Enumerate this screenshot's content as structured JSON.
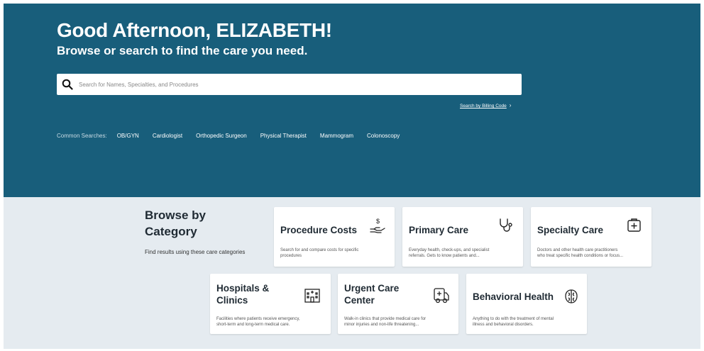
{
  "hero": {
    "greeting": "Good Afternoon, ELIZABETH!",
    "subtitle": "Browse or search to find the care you need.",
    "search_placeholder": "Search for Names, Specialties, and Procedures",
    "billing_link": "Search by Billing Code",
    "common_label": "Common Searches:",
    "common_searches": [
      "OB/GYN",
      "Cardiologist",
      "Orthopedic Surgeon",
      "Physical Therapist",
      "Mammogram",
      "Colonoscopy"
    ]
  },
  "browse": {
    "title": "Browse by\nCategory",
    "description": "Find results using these care categories"
  },
  "categories": [
    {
      "title": "Procedure Costs",
      "icon": "hand-dollar-icon",
      "description": "Search for and compare costs for specific\nprocedures"
    },
    {
      "title": "Primary Care",
      "icon": "stethoscope-icon",
      "description": "Everyday health, check-ups, and specialist\nreferrals. Gets to know patients and..."
    },
    {
      "title": "Specialty Care",
      "icon": "medical-kit-icon",
      "description": "Doctors and other health care practitioners\nwho treat specific health conditions or focus..."
    },
    {
      "title": "Hospitals &\nClinics",
      "icon": "hospital-icon",
      "description": "Facilities where patients receive emergency,\nshort-term and long-term medical care."
    },
    {
      "title": "Urgent Care\nCenter",
      "icon": "ambulance-icon",
      "description": "Walk-in clinics that provide medical care for\nminor injuries and non-life threatening..."
    },
    {
      "title": "Behavioral Health",
      "icon": "brain-icon",
      "description": "Anything to do with the treatment of mental\nillness and behavioral disorders."
    }
  ],
  "colors": {
    "hero_bg": "#185e7b",
    "lower_bg": "#e5ebf0",
    "card_bg": "#ffffff"
  }
}
